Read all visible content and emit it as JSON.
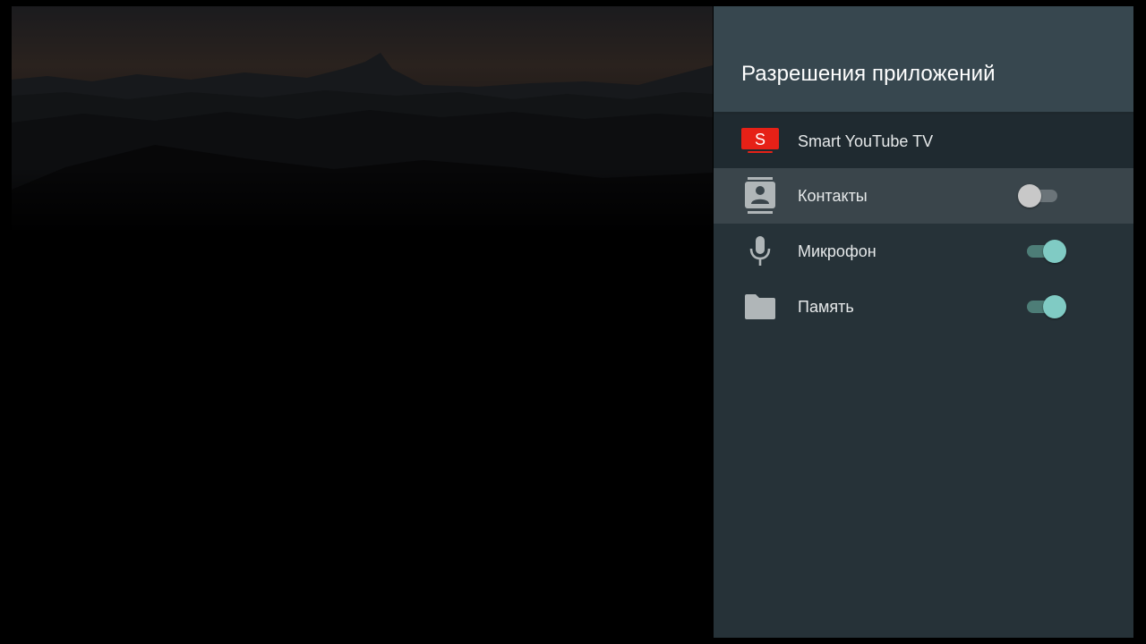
{
  "panel": {
    "title": "Разрешения приложений"
  },
  "app": {
    "name": "Smart YouTube TV",
    "icon_letter": "S",
    "icon": "smart-youtube-tv-logo",
    "icon_color": "#e62117"
  },
  "permissions": [
    {
      "label": "Контакты",
      "icon": "contacts-icon",
      "enabled": false,
      "focused": true
    },
    {
      "label": "Микрофон",
      "icon": "microphone-icon",
      "enabled": true,
      "focused": false
    },
    {
      "label": "Память",
      "icon": "folder-icon",
      "enabled": true,
      "focused": false
    }
  ],
  "colors": {
    "panel_bg": "#263238",
    "header_bg": "#37474f",
    "toggle_on": "#80cbc4",
    "toggle_off": "#c8c8c8"
  }
}
